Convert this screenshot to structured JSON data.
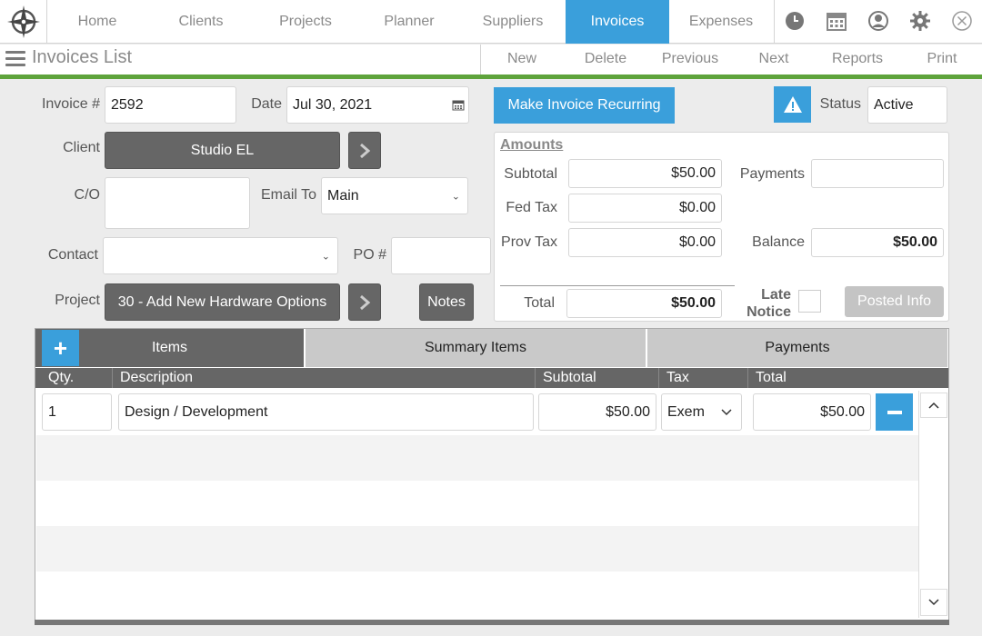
{
  "nav": {
    "tabs": [
      "Home",
      "Clients",
      "Projects",
      "Planner",
      "Suppliers",
      "Invoices",
      "Expenses"
    ],
    "active": "Invoices",
    "icons": [
      "clock-icon",
      "calendar-icon",
      "user-icon",
      "gear-icon",
      "close-icon"
    ]
  },
  "toolbar": {
    "title": "Invoices List",
    "buttons": [
      "New",
      "Delete",
      "Previous",
      "Next",
      "Reports",
      "Print"
    ]
  },
  "form": {
    "invoice_label": "Invoice #",
    "invoice_value": "2592",
    "date_label": "Date",
    "date_value": "Jul 30, 2021",
    "recurring_button": "Make Invoice Recurring",
    "status_label": "Status",
    "status_value": "Active",
    "client_label": "Client",
    "client_value": "Studio EL",
    "co_label": "C/O",
    "co_value": "",
    "email_label": "Email To",
    "email_value": "Main",
    "contact_label": "Contact",
    "contact_value": "",
    "po_label": "PO #",
    "po_value": "",
    "project_label": "Project",
    "project_value": "30 - Add New Hardware Options",
    "notes_button": "Notes"
  },
  "amounts": {
    "heading": "Amounts",
    "subtotal_label": "Subtotal",
    "subtotal": "$50.00",
    "fedtax_label": "Fed Tax",
    "fedtax": "$0.00",
    "provtax_label": "Prov Tax",
    "provtax": "$0.00",
    "total_label": "Total",
    "total": "$50.00",
    "payments_label": "Payments",
    "payments": "",
    "balance_label": "Balance",
    "balance": "$50.00",
    "late_label_1": "Late",
    "late_label_2": "Notice",
    "posted_button": "Posted Info"
  },
  "tabs": {
    "items": "Items",
    "summary": "Summary Items",
    "payments": "Payments"
  },
  "table": {
    "headers": [
      "Qty.",
      "Description",
      "Subtotal",
      "Tax",
      "Total"
    ],
    "rows": [
      {
        "qty": "1",
        "description": "Design / Development",
        "subtotal": "$50.00",
        "tax": "Exem",
        "total": "$50.00"
      }
    ]
  },
  "colors": {
    "accent": "#3a9fdb",
    "green": "#5ea33b",
    "dark": "#666666"
  }
}
